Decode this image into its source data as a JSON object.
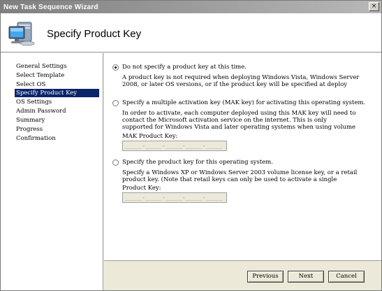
{
  "window": {
    "title": "New Task Sequence Wizard",
    "close_glyph": "×"
  },
  "header": {
    "title": "Specify Product Key",
    "icon": "computer-monitor-icon"
  },
  "sidebar": {
    "items": [
      {
        "label": "General Settings",
        "active": false
      },
      {
        "label": "Select Template",
        "active": false
      },
      {
        "label": "Select OS",
        "active": false
      },
      {
        "label": "Specify Product Key",
        "active": true
      },
      {
        "label": "OS Settings",
        "active": false
      },
      {
        "label": "Admin Password",
        "active": false
      },
      {
        "label": "Summary",
        "active": false
      },
      {
        "label": "Progress",
        "active": false
      },
      {
        "label": "Confirmation",
        "active": false
      }
    ]
  },
  "options": [
    {
      "label": "Do not specify a product key at this time.",
      "checked": true,
      "description": [
        "A product key is not required when deploying Windows Vista, Windows Server",
        "2008, or later OS versions, or if the product key will be specified at deploy"
      ]
    },
    {
      "label": "Specify a multiple activation key (MAK key) for activating this operating system.",
      "checked": false,
      "description": [
        "In order to activate, each computer deployed using this MAK key will need to",
        "contact the Microsoft activation service on the internet.  This is only",
        "supported for Windows Vista and later operating systems when using volume"
      ],
      "field_label": "MAK Product Key:",
      "field_mask": "_____-_____-_____-_____-_____"
    },
    {
      "label": "Specify the product key for this operating system.",
      "checked": false,
      "description": [
        "Specify a Windows XP or Windows Server 2003 volume license key, or a retail",
        "product key.  (Note that retail keys can only be used to activate a single"
      ],
      "field_label": "Product Key:",
      "field_mask": "_____-_____-_____-_____-_____"
    }
  ],
  "buttons": {
    "previous": "Previous",
    "next": "Next",
    "cancel": "Cancel"
  }
}
